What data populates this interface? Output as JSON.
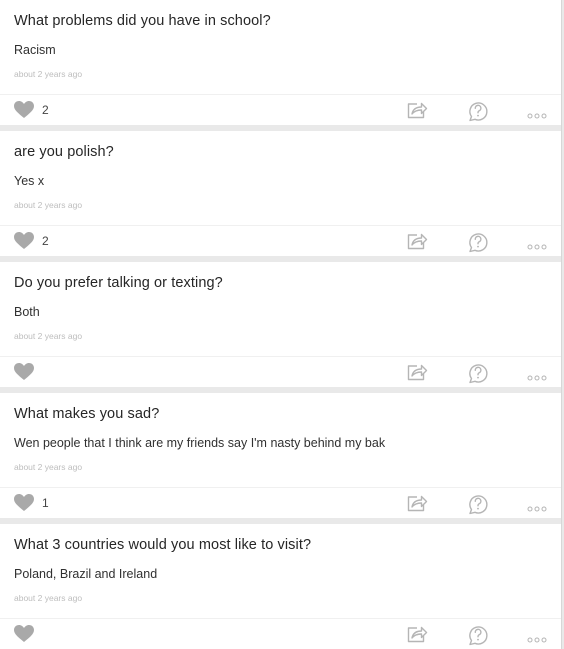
{
  "posts": [
    {
      "question": "What problems did you have in school?",
      "answer": "Racism",
      "time": "about 2 years ago",
      "likes": "2"
    },
    {
      "question": "are you polish?",
      "answer": "Yes x",
      "time": "about 2 years ago",
      "likes": "2"
    },
    {
      "question": "Do you prefer talking or texting?",
      "answer": "Both",
      "time": "about 2 years ago",
      "likes": ""
    },
    {
      "question": "What makes you sad?",
      "answer": "Wen people that I think are my friends say I'm nasty behind my bak",
      "time": "about 2 years ago",
      "likes": "1"
    },
    {
      "question": "What 3 countries would you most like to visit?",
      "answer": "Poland, Brazil and Ireland",
      "time": "about 2 years ago",
      "likes": ""
    }
  ],
  "icons": {
    "like": "heart-icon",
    "share": "share-icon",
    "ask": "ask-question-icon",
    "more": "more-options-icon"
  },
  "colors": {
    "background": "#e9e9e9",
    "card": "#ffffff",
    "icon": "#b5b5b5",
    "heart": "#a9a9a9",
    "time": "#bdbdbd"
  }
}
